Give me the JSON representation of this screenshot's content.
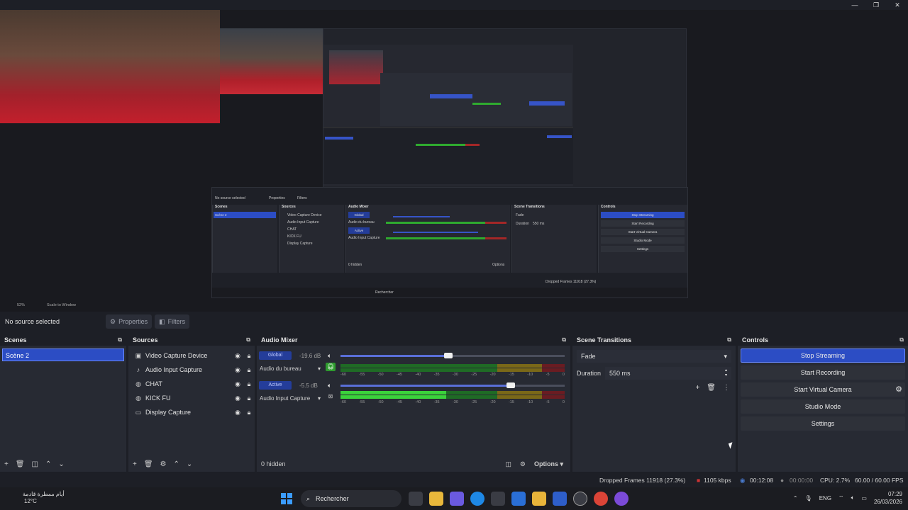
{
  "window": {
    "minimize": "—",
    "maximize": "❐",
    "close": "✕"
  },
  "preview": {
    "zoom": "52%",
    "scale_mode": "Scale to Window",
    "embedded": {
      "no_source": "No source selected",
      "properties": "Properties",
      "filters": "Filters",
      "scenes_title": "Scenes",
      "scene": "Scène 2",
      "sources_title": "Sources",
      "sources": [
        "Video Capture Device",
        "Audio Input Capture",
        "CHAT",
        "KICK FU",
        "Display Capture"
      ],
      "mixer_title": "Audio Mixer",
      "mixer_rows": [
        "Global",
        "Audio du bureau",
        "Active",
        "Audio Input Capture"
      ],
      "transitions_title": "Scene Transitions",
      "transition": "Fade",
      "duration_label": "Duration",
      "duration_value": "550 ms",
      "controls_title": "Controls",
      "controls": [
        "Stop Streaming",
        "Start Recording",
        "Start Virtual Camera",
        "Studio Mode",
        "Settings"
      ],
      "hidden": "0 hidden",
      "options": "Options",
      "search": "Rechercher",
      "status": "Dropped Frames 11918 (27.3%)"
    }
  },
  "propbar": {
    "no_source": "No source selected",
    "properties": "Properties",
    "filters": "Filters"
  },
  "scenes": {
    "title": "Scenes",
    "items": [
      "Scène 2"
    ]
  },
  "sources": {
    "title": "Sources",
    "items": [
      {
        "name": "Video Capture Device",
        "icon": "camera-icon"
      },
      {
        "name": "Audio Input Capture",
        "icon": "microphone-icon"
      },
      {
        "name": "CHAT",
        "icon": "globe-icon"
      },
      {
        "name": "KICK FU",
        "icon": "globe-icon"
      },
      {
        "name": "Display Capture",
        "icon": "monitor-icon"
      }
    ]
  },
  "mixer": {
    "title": "Audio Mixer",
    "channels": [
      {
        "pill": "Global",
        "db": "-19.6 dB",
        "name": "Audio du bureau",
        "fader": 0.48,
        "level": 0
      },
      {
        "pill": "Active",
        "db": "-5.5 dB",
        "name": "Audio Input Capture",
        "fader": 0.76,
        "level": 0.47
      }
    ],
    "ticks": [
      "-60",
      "-55",
      "-50",
      "-45",
      "-40",
      "-35",
      "-30",
      "-25",
      "-20",
      "-15",
      "-10",
      "-5",
      "0"
    ],
    "hidden": "0 hidden",
    "options": "Options"
  },
  "transitions": {
    "title": "Scene Transitions",
    "selected": "Fade",
    "duration_label": "Duration",
    "duration_value": "550 ms"
  },
  "controls": {
    "title": "Controls",
    "stop_streaming": "Stop Streaming",
    "start_recording": "Start Recording",
    "start_virtual_camera": "Start Virtual Camera",
    "studio_mode": "Studio Mode",
    "settings": "Settings"
  },
  "status": {
    "dropped": "Dropped Frames 11918 (27.3%)",
    "bitrate": "1105 kbps",
    "stream_time": "00:12:08",
    "rec_time": "00:00:00",
    "cpu": "CPU: 2.7%",
    "fps": "60.00 / 60.00 FPS"
  },
  "taskbar": {
    "weather_text": "أيام ممطرة قادمة",
    "weather_temp": "12°C",
    "search": "Rechercher",
    "lang": "ENG",
    "time": "07:29",
    "date": "26/03/2026"
  },
  "colors": {
    "accent": "#2c4dc4",
    "meter_green": "#3bd23b",
    "meter_yellow": "#7a6818",
    "meter_red": "#6a1c22"
  }
}
